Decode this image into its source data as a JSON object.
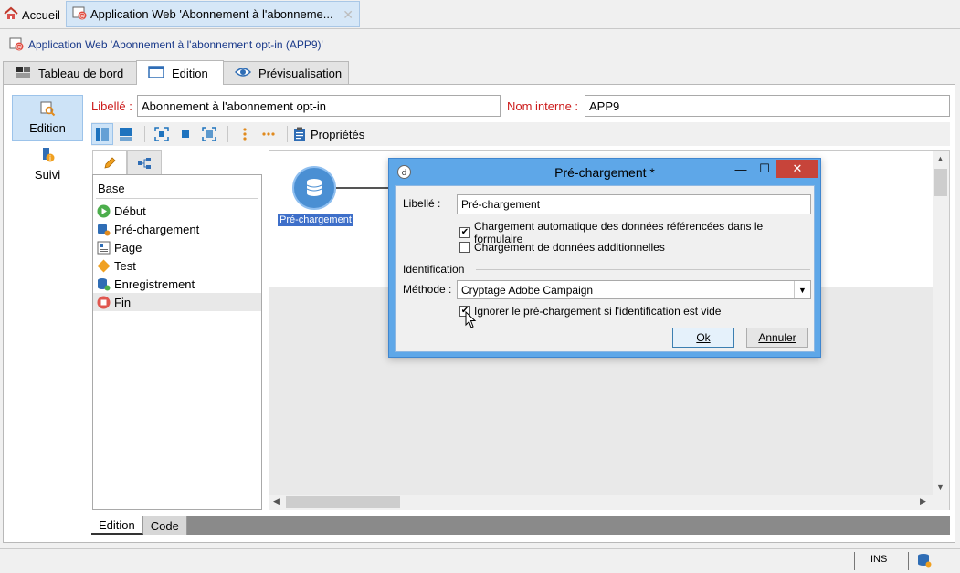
{
  "topbar": {
    "home_label": "Accueil",
    "doc_tab_label": "Application Web 'Abonnement à l'abonneme..."
  },
  "breadcrumb": {
    "text": "Application Web 'Abonnement à l'abonnement opt-in (APP9)'"
  },
  "main_tabs": [
    {
      "label": "Tableau de bord",
      "active": false
    },
    {
      "label": "Edition",
      "active": true
    },
    {
      "label": "Prévisualisation",
      "active": false
    }
  ],
  "sidebar": {
    "items": [
      {
        "label": "Edition",
        "active": true
      },
      {
        "label": "Suivi",
        "active": false
      }
    ]
  },
  "form": {
    "libelle_label": "Libellé :",
    "libelle_value": "Abonnement à l'abonnement opt-in",
    "nom_interne_label": "Nom interne :",
    "nom_interne_value": "APP9"
  },
  "toolbar": {
    "properties_label": "Propriétés"
  },
  "palette": {
    "header": "Base",
    "items": [
      "Début",
      "Pré-chargement",
      "Page",
      "Test",
      "Enregistrement",
      "Fin"
    ],
    "selected": "Fin"
  },
  "canvas": {
    "node_label": "Pré-chargement"
  },
  "bottom_tabs": [
    {
      "label": "Edition",
      "active": true
    },
    {
      "label": "Code",
      "active": false
    }
  ],
  "status": {
    "ins": "INS"
  },
  "dialog": {
    "title": "Pré-chargement *",
    "libelle_label": "Libellé :",
    "libelle_value": "Pré-chargement",
    "chk_auto_label": "Chargement automatique des données référencées dans le formulaire",
    "chk_auto_checked": true,
    "chk_additional_label": "Chargement de données additionnelles",
    "chk_additional_checked": false,
    "section_identification": "Identification",
    "methode_label": "Méthode :",
    "methode_value": "Cryptage Adobe Campaign",
    "chk_ignore_label": "Ignorer le pré-chargement si l'identification est vide",
    "chk_ignore_checked": true,
    "ok_label": "Ok",
    "cancel_label": "Annuler"
  },
  "colors": {
    "accent": "#5ea7e8",
    "required_label": "#cc1c1c",
    "selection": "#3e6fc9"
  }
}
